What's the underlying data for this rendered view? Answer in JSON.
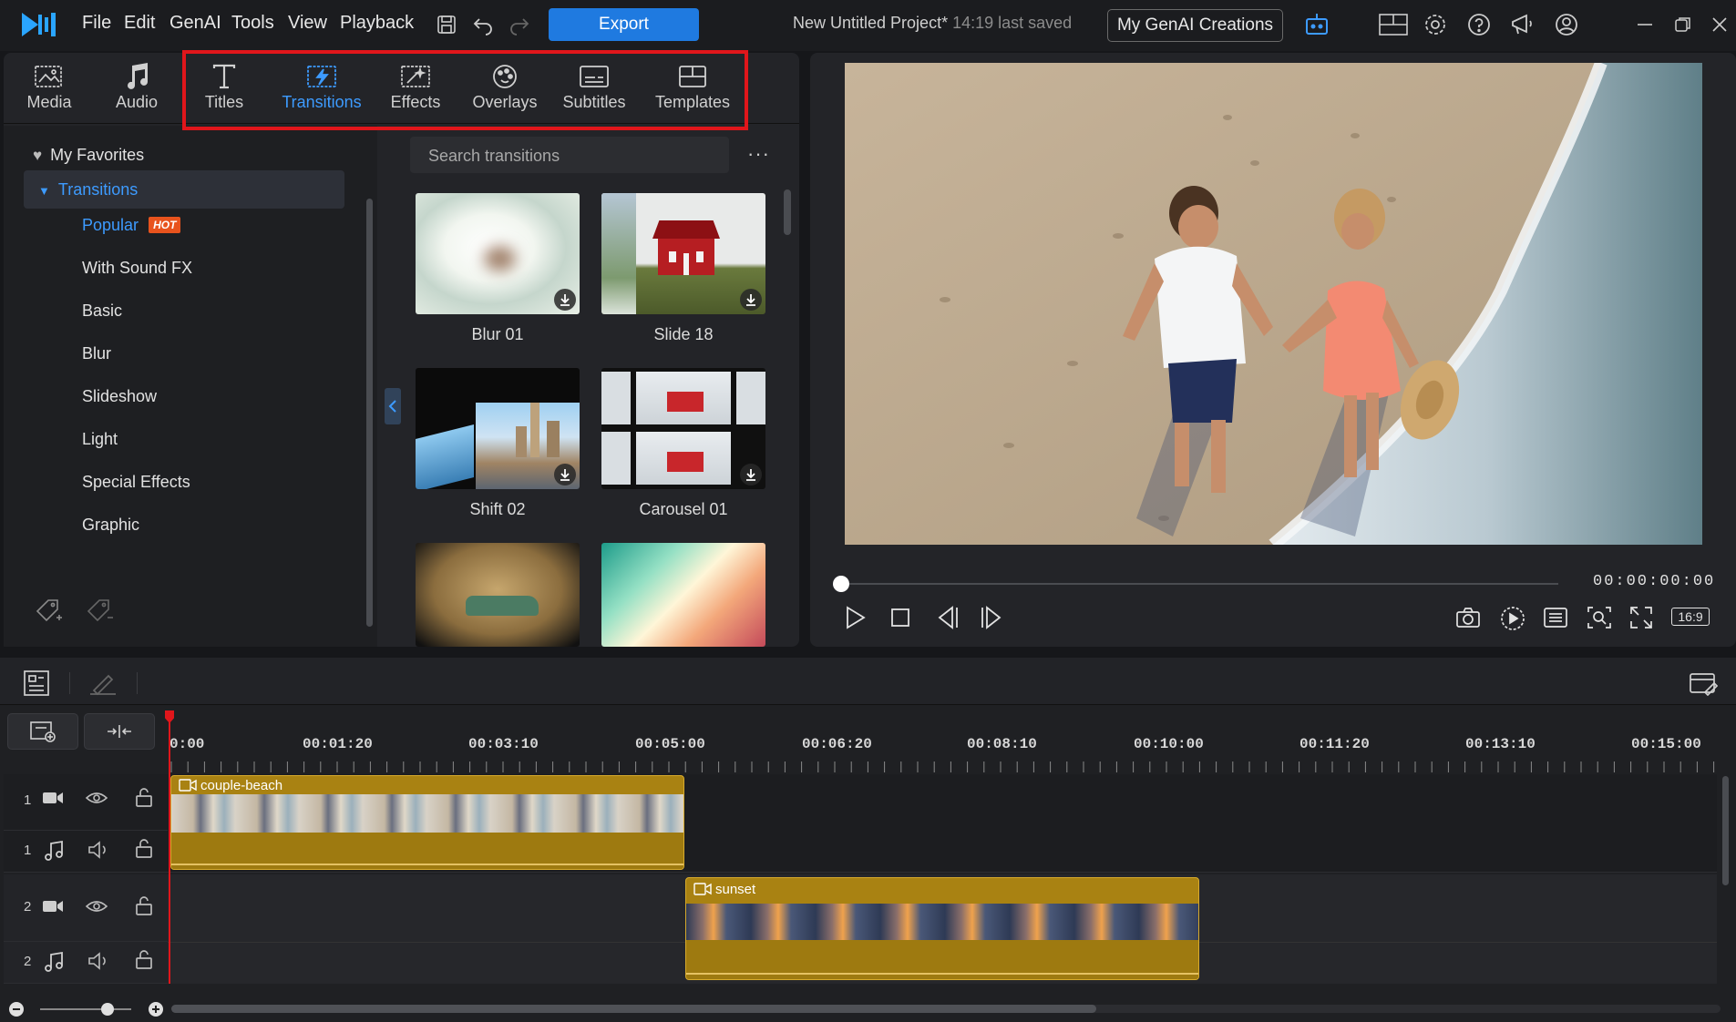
{
  "menu": {
    "items": [
      "File",
      "Edit",
      "GenAI",
      "Tools",
      "View",
      "Playback"
    ]
  },
  "toolbar": {
    "export_label": "Export",
    "genai_label": "My GenAI Creations"
  },
  "project": {
    "title": "New Untitled Project*",
    "saved": "14:19 last saved"
  },
  "library": {
    "tabs": [
      {
        "label": "Media",
        "icon": "media-icon"
      },
      {
        "label": "Audio",
        "icon": "music-note-icon"
      },
      {
        "label": "Titles",
        "icon": "text-T-icon"
      },
      {
        "label": "Transitions",
        "icon": "transitions-icon"
      },
      {
        "label": "Effects",
        "icon": "effects-icon"
      },
      {
        "label": "Overlays",
        "icon": "overlays-icon"
      },
      {
        "label": "Subtitles",
        "icon": "subtitles-icon"
      },
      {
        "label": "Templates",
        "icon": "templates-icon"
      }
    ],
    "active_tab": "Transitions",
    "favorites": "My Favorites",
    "category_root": "Transitions",
    "categories": [
      "Popular",
      "With Sound FX",
      "Basic",
      "Blur",
      "Slideshow",
      "Light",
      "Special Effects",
      "Graphic"
    ],
    "hot_badge": "HOT",
    "search_placeholder": "Search transitions",
    "more": "···",
    "items": [
      {
        "label": "Blur 01"
      },
      {
        "label": "Slide 18"
      },
      {
        "label": "Shift 02"
      },
      {
        "label": "Carousel 01"
      }
    ]
  },
  "preview": {
    "timecode": "00:00:00:00",
    "aspect": "16:9"
  },
  "timeline": {
    "ruler": [
      "0:00",
      "00:01:20",
      "00:03:10",
      "00:05:00",
      "00:06:20",
      "00:08:10",
      "00:10:00",
      "00:11:20",
      "00:13:10",
      "00:15:00"
    ],
    "tracks": [
      {
        "num": "1",
        "type": "video"
      },
      {
        "num": "1",
        "type": "audio"
      },
      {
        "num": "2",
        "type": "video"
      },
      {
        "num": "2",
        "type": "audio"
      }
    ],
    "clips": [
      {
        "name": "couple-beach"
      },
      {
        "name": "sunset"
      }
    ]
  },
  "colors": {
    "accent": "#1f7ae0",
    "clip": "#a98212",
    "highlight": "#e0161b",
    "hot": "#e8531d"
  }
}
